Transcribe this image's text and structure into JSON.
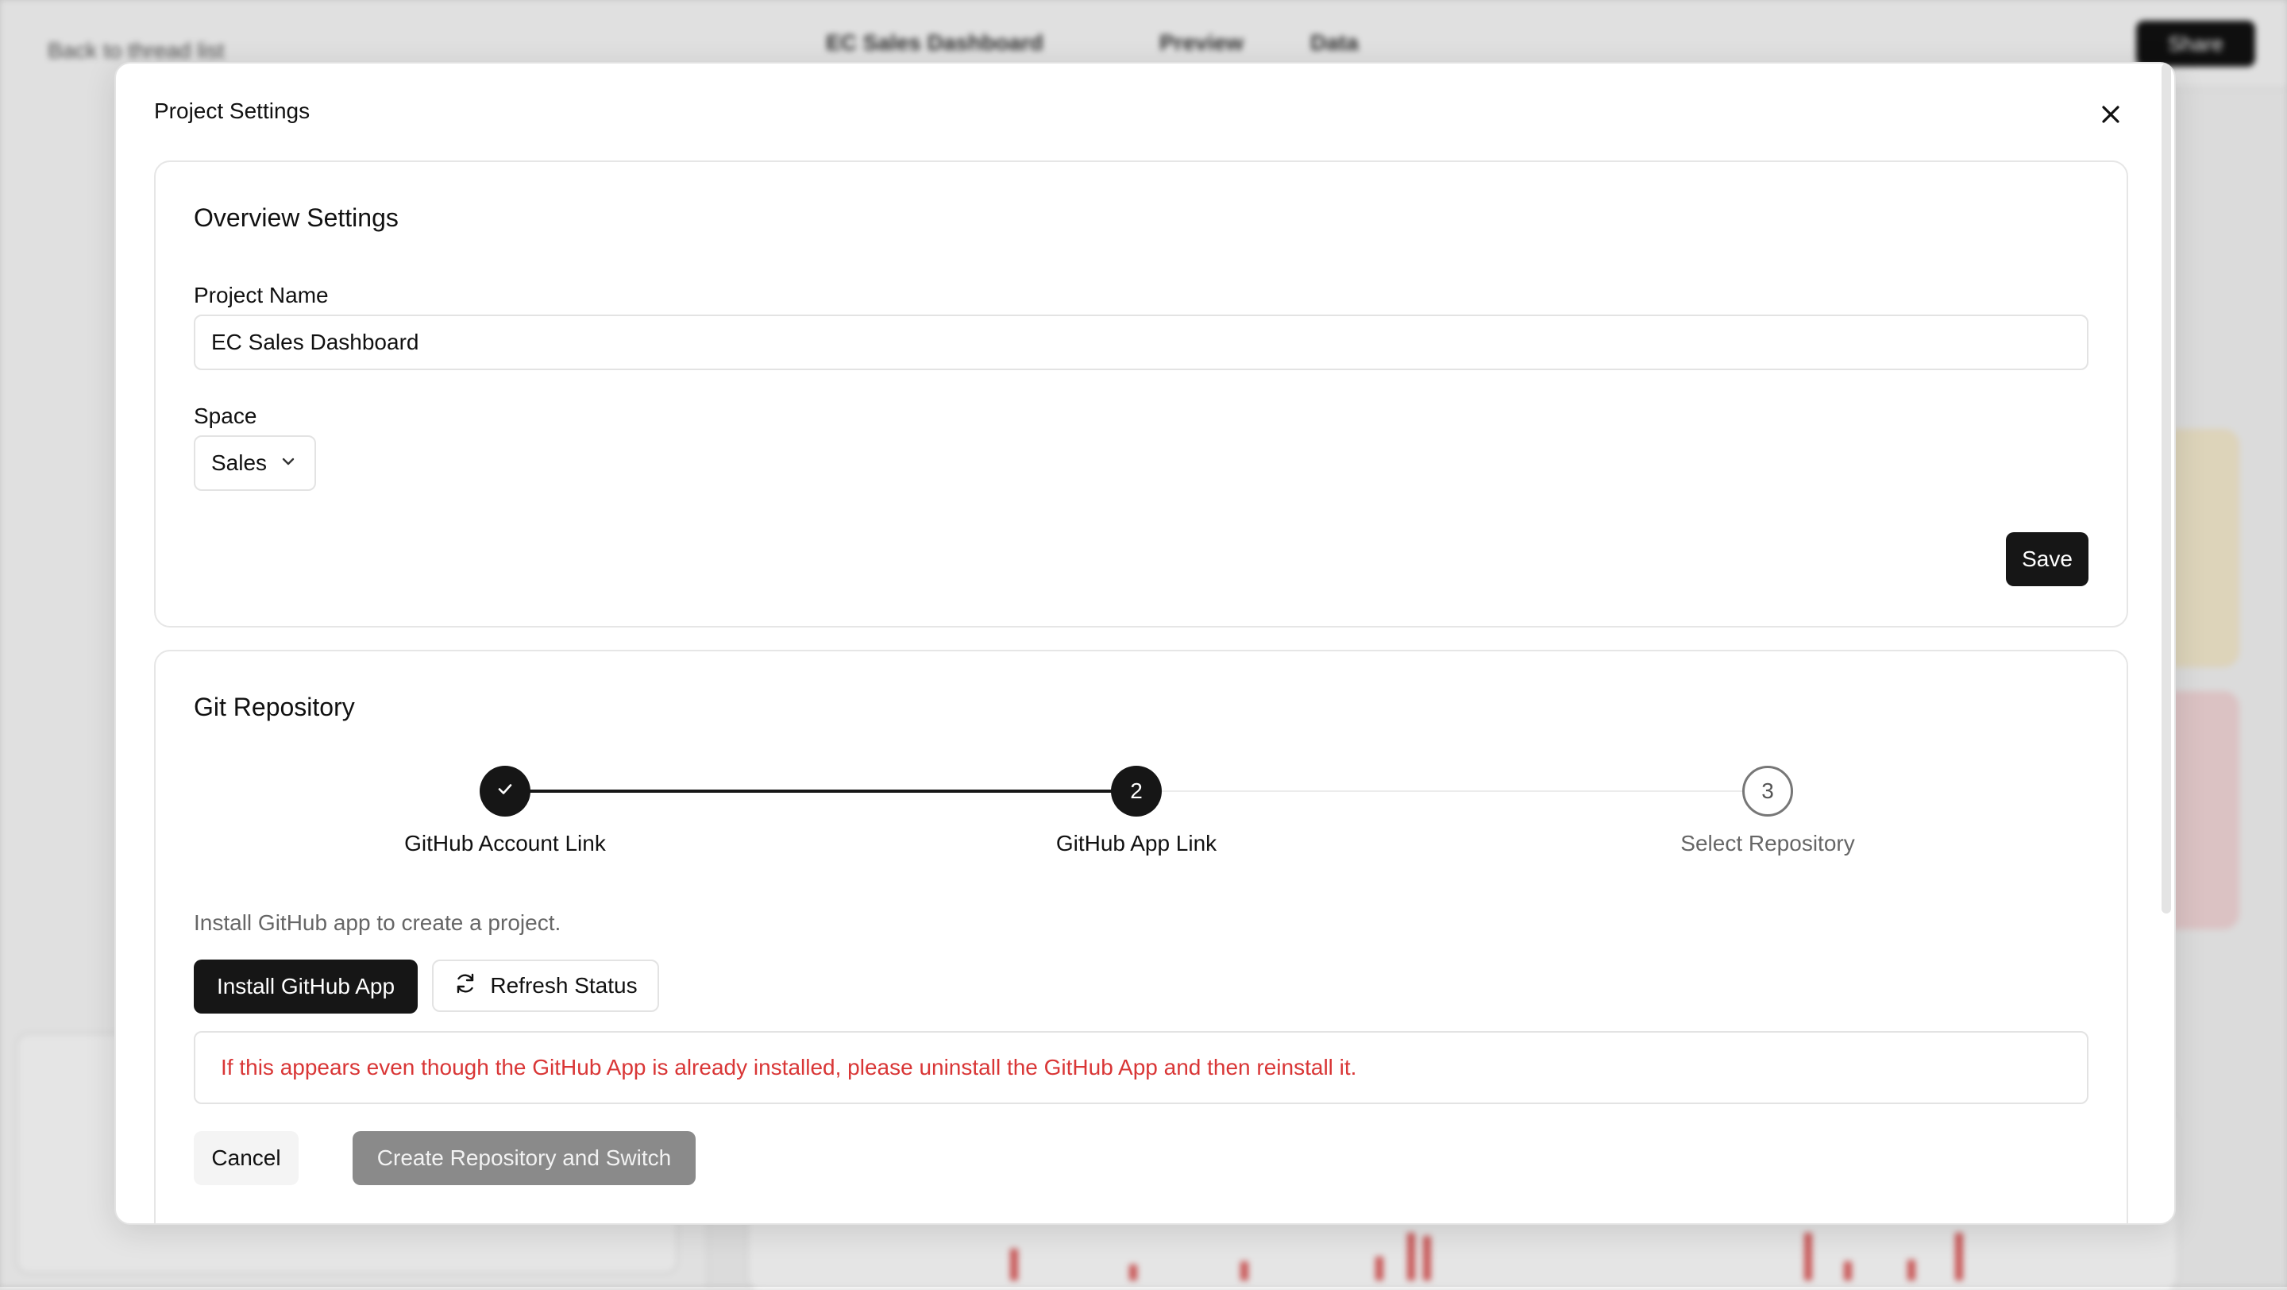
{
  "background": {
    "back_link": "Back to thread list",
    "dashboard_tab": "EC Sales Dashboard",
    "preview_tab": "Preview",
    "data_tab": "Data",
    "share_label": "Share"
  },
  "modal": {
    "title": "Project Settings"
  },
  "overview": {
    "title": "Overview Settings",
    "project_name_label": "Project Name",
    "project_name_value": "EC Sales Dashboard",
    "space_label": "Space",
    "space_value": "Sales",
    "save_label": "Save"
  },
  "git": {
    "title": "Git Repository",
    "steps": [
      {
        "number": "1",
        "label": "GitHub Account Link",
        "status": "done"
      },
      {
        "number": "2",
        "label": "GitHub App Link",
        "status": "current"
      },
      {
        "number": "3",
        "label": "Select Repository",
        "status": "pending"
      }
    ],
    "hint": "Install GitHub app to create a project.",
    "install_label": "Install GitHub App",
    "refresh_label": "Refresh Status",
    "alert": "If this appears even though the GitHub App is already installed, please uninstall the GitHub App and then reinstall it.",
    "cancel_label": "Cancel",
    "create_label": "Create Repository and Switch"
  },
  "colors": {
    "accent_dark": "#161616",
    "error_text": "#d93636",
    "disabled_button": "#8a8a8a"
  },
  "icons": [
    "close-icon",
    "chevron-down-icon",
    "check-icon",
    "refresh-icon"
  ]
}
